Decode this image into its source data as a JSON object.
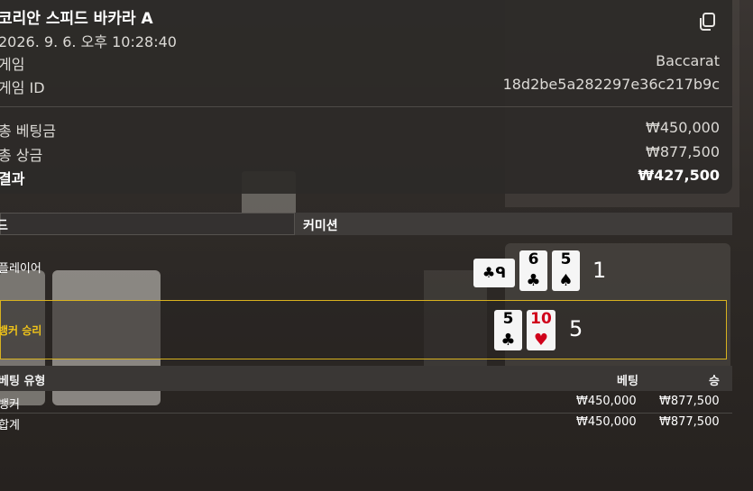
{
  "header": {
    "title": "코리안 스피드 바카라 A",
    "datetime": "2026. 9. 6. 오후 10:28:40",
    "copy_icon": "copy-icon",
    "rows": [
      {
        "key": "게임",
        "value": "Baccarat"
      },
      {
        "key": "게임 ID",
        "value": "18d2be5a282297e36c217b9c"
      }
    ],
    "summary": [
      {
        "key": "총 베팅금",
        "value": "₩450,000"
      },
      {
        "key": "총 상금",
        "value": "₩877,500"
      },
      {
        "key": "결과",
        "value": "₩427,500"
      }
    ]
  },
  "round": {
    "mode_label": "드",
    "commission_label": "커미션"
  },
  "hands": {
    "player": {
      "label": "플레이어",
      "cards": [
        {
          "rank": "♣",
          "suit": "ᑫ",
          "note": "sideways"
        },
        {
          "rank": "6",
          "suit": "♣"
        },
        {
          "rank": "5",
          "suit": "♠"
        }
      ],
      "score": "1"
    },
    "banker": {
      "label": "뱅커 승리",
      "cards": [
        {
          "rank": "5",
          "suit": "♣"
        },
        {
          "rank": "10",
          "suit": "♥"
        }
      ],
      "score": "5"
    }
  },
  "bets_table": {
    "headers": {
      "type": "베팅 유형",
      "bet": "베팅",
      "win": "승"
    },
    "rows": [
      {
        "type": "뱅커",
        "bet": "₩450,000",
        "win": "₩877,500"
      },
      {
        "type": "합계",
        "bet": "₩450,000",
        "win": "₩877,500"
      }
    ]
  },
  "colors": {
    "accent": "#f0c419",
    "card_red": "#d0021b",
    "panel": "#2d2a28"
  }
}
